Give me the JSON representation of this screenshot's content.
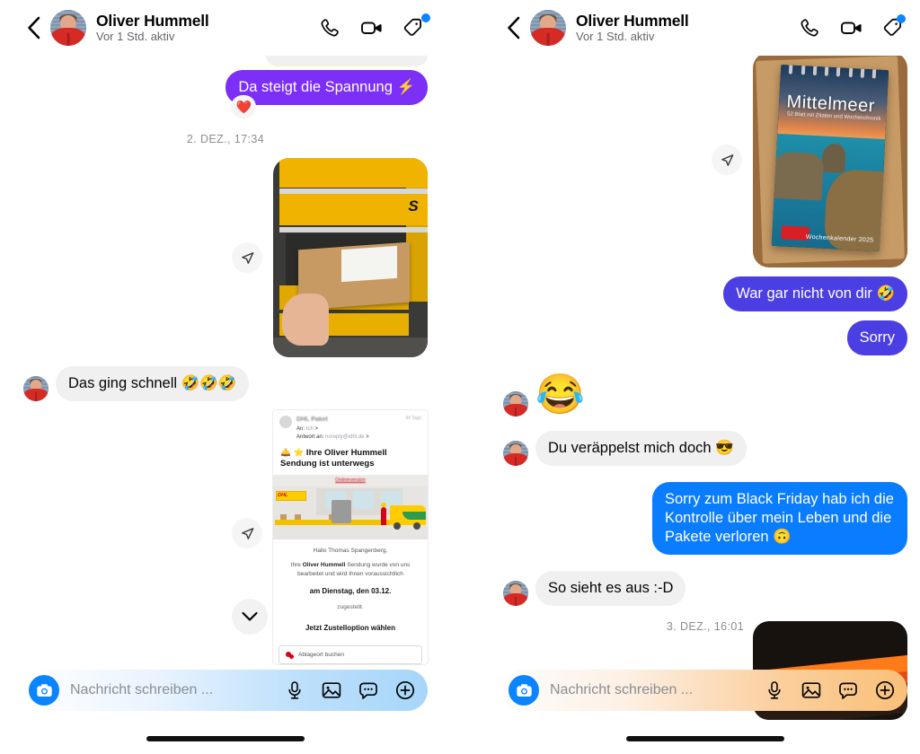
{
  "header": {
    "back_icon": "chevron-left-icon",
    "name": "Oliver Hummell",
    "status": "Vor 1 Std. aktiv",
    "call_icon": "phone-icon",
    "video_icon": "video-camera-icon",
    "tag_icon": "tag-icon",
    "badge": "notification-dot"
  },
  "left_panel": {
    "messages": [
      {
        "id": "m1",
        "type": "partial-bubble",
        "direction": "incoming",
        "text": ""
      },
      {
        "id": "m2",
        "type": "text",
        "direction": "outgoing",
        "style": "purple",
        "text": "Da steigt die Spannung ⚡",
        "reaction": "❤️"
      },
      {
        "id": "m3",
        "type": "timestamp",
        "text": "2. DEZ., 17:34"
      },
      {
        "id": "m4",
        "type": "photo",
        "direction": "outgoing",
        "alt": "Paket in gelber DHL Packstation",
        "forward_icon": "forward-icon"
      },
      {
        "id": "m5",
        "type": "text",
        "direction": "incoming",
        "style": "grey",
        "text": "Das ging schnell 🤣🤣🤣"
      },
      {
        "id": "m6",
        "type": "email-screenshot",
        "direction": "outgoing",
        "forward_icon": "forward-icon",
        "scroll_icon": "chevron-down-icon"
      }
    ],
    "email": {
      "from": "DHL Paket",
      "to_label": "An:",
      "to_value": "Ich",
      "reply_label": "Antwort an:",
      "reply_value": "noreply@idhl.de",
      "time": "44 Tage",
      "subject": "🛎️ ⭐ Ihre Oliver Hummell Sendung ist unterwegs",
      "online_version": "Onlineversion",
      "dhl_logo": "DHL",
      "greeting": "Hallo Thomas Spangenberg,",
      "para_pre": "Ihre ",
      "para_bold": "Oliver Hummell",
      "para_post": " Sendung wurde von uns bearbeitet und wird Ihnen voraussichtlich",
      "date": "am Dienstag, den 03.12.",
      "delivered": "zugestellt.",
      "option_title": "Jetzt Zustelloption wählen",
      "option_button": "Ablageort buchen"
    },
    "composer": {
      "camera_icon": "camera-icon",
      "placeholder": "Nachricht schreiben ...",
      "value": "",
      "mic_icon": "microphone-icon",
      "gallery_icon": "image-icon",
      "sticker_icon": "sticker-icon",
      "plus_icon": "plus-circle-icon"
    }
  },
  "right_panel": {
    "messages": [
      {
        "id": "r1",
        "type": "photo",
        "direction": "outgoing",
        "alt": "Mittelmeer Wochenkalender auf Karton",
        "forward_icon": "forward-icon"
      },
      {
        "id": "r2",
        "type": "text",
        "direction": "outgoing",
        "style": "indigo",
        "text": "War gar nicht von dir 🤣"
      },
      {
        "id": "r3",
        "type": "text",
        "direction": "outgoing",
        "style": "indigo",
        "text": "Sorry"
      },
      {
        "id": "r4",
        "type": "emoji",
        "direction": "incoming",
        "text": "😂"
      },
      {
        "id": "r5",
        "type": "text",
        "direction": "incoming",
        "style": "grey",
        "text": "Du veräppelst mich doch 😎"
      },
      {
        "id": "r6",
        "type": "text",
        "direction": "outgoing",
        "style": "blue",
        "text": "Sorry zum Black Friday hab ich die Kontrolle über mein Leben und die Pakete verloren 🙃"
      },
      {
        "id": "r7",
        "type": "text",
        "direction": "incoming",
        "style": "grey",
        "text": "So sieht es aus :-D"
      },
      {
        "id": "r8",
        "type": "timestamp",
        "text": "3. DEZ., 16:01"
      },
      {
        "id": "r9",
        "type": "photo-peek",
        "direction": "outgoing",
        "alt": "Dunkles Foto mit orangem Sonnenuntergang"
      }
    ],
    "book": {
      "title": "Mittelmeer",
      "subtitle": "52 Blatt mit Zitaten und Wochenchronik",
      "footer": "Wochenkalender 2025"
    },
    "composer": {
      "camera_icon": "camera-icon",
      "placeholder": "Nachricht schreiben ...",
      "value": "",
      "mic_icon": "microphone-icon",
      "gallery_icon": "image-icon",
      "sticker_icon": "sticker-icon",
      "plus_icon": "plus-circle-icon"
    }
  },
  "colors": {
    "purple": "#7b2ff7",
    "indigo": "#4b3fe4",
    "blue": "#0a7cff",
    "grey_bubble": "#f0f0f0",
    "accent": "#0a84ff",
    "text": "#050505",
    "muted": "#8a8d91"
  }
}
